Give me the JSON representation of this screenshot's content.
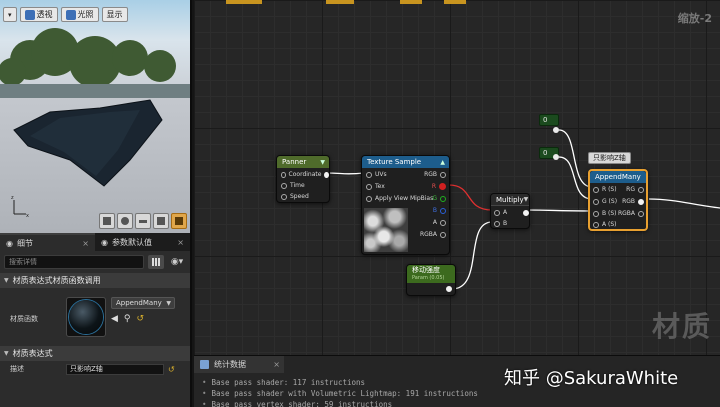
{
  "viewport": {
    "toolbar": {
      "perspective_label": "透视",
      "lit_label": "光照",
      "show_label": "显示"
    }
  },
  "details_panel": {
    "tabs": [
      {
        "label": "细节"
      },
      {
        "label": "参数默认值"
      }
    ],
    "search_placeholder": "搜索详情",
    "category_function_call": "材质表达式材质函数调用",
    "material_function_label": "材质函数",
    "material_function_value": "AppendMany",
    "category_expression": "材质表达式",
    "description_label": "描述",
    "description_value": "只影响Z轴"
  },
  "graph": {
    "zoom_label": "缩放-2",
    "watermark": "材质",
    "nodes": {
      "panner": {
        "title": "Panner",
        "pins": [
          "Coordinate",
          "Time",
          "Speed"
        ]
      },
      "texture_sample": {
        "title": "Texture Sample",
        "inputs": [
          "UVs",
          "Tex",
          "Apply View MipBias"
        ],
        "outputs": [
          "RGB",
          "R",
          "G",
          "B",
          "A",
          "RGBA"
        ]
      },
      "multiply": {
        "title": "Multiply",
        "inputs": [
          "A",
          "B"
        ]
      },
      "scalar_param": {
        "title": "移动强度",
        "subtitle": "Param (0.05)"
      },
      "const_top": {
        "value": "0"
      },
      "const_mid": {
        "value": "0"
      },
      "append_many": {
        "title": "AppendMany",
        "inputs": [
          "R (S)",
          "G (S)",
          "B (S)",
          "A (S)"
        ],
        "outputs": [
          "RG",
          "RGB",
          "RGBA"
        ]
      }
    },
    "tooltip": "只影响Z轴"
  },
  "stats": {
    "tab_label": "统计数据",
    "lines": [
      "Base pass shader: 117 instructions",
      "Base pass shader with Volumetric Lightmap: 191 instructions",
      "Base pass vertex shader: 59 instructions"
    ]
  },
  "signature": "知乎 @SakuraWhite",
  "colors": {
    "node_header_panner": "#4f6b2b",
    "node_header_texture": "#1d5d8c",
    "node_header_generic": "#2a2a2a",
    "constant_bg": "#1b4a1e",
    "selection_orange": "#e8a030",
    "pin_red": "#d02020",
    "pin_green": "#20b020",
    "pin_blue": "#2a5fd8"
  }
}
